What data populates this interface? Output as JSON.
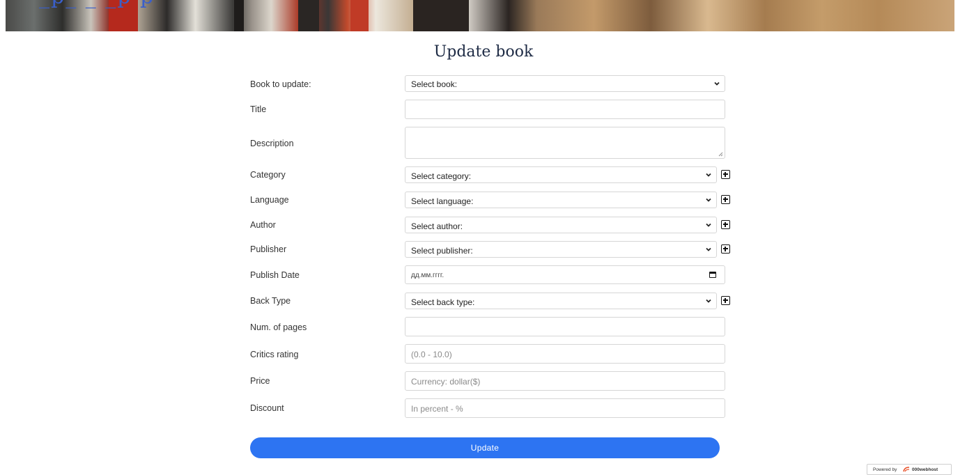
{
  "header": {
    "link_text": "_p_ _ _p p"
  },
  "page_title": "Update book",
  "form": {
    "book_to_update": {
      "label": "Book to update:",
      "value": "Select book:"
    },
    "title": {
      "label": "Title",
      "value": ""
    },
    "description": {
      "label": "Description",
      "value": ""
    },
    "category": {
      "label": "Category",
      "value": "Select category:"
    },
    "language": {
      "label": "Language",
      "value": "Select language:"
    },
    "author": {
      "label": "Author",
      "value": "Select author:"
    },
    "publisher": {
      "label": "Publisher",
      "value": "Select publisher:"
    },
    "publish_date": {
      "label": "Publish Date",
      "placeholder": "дд.мм.гггг."
    },
    "back_type": {
      "label": "Back Type",
      "value": "Select back type:"
    },
    "num_pages": {
      "label": "Num. of pages",
      "value": ""
    },
    "critics_rating": {
      "label": "Critics rating",
      "placeholder": "(0.0 - 10.0)"
    },
    "price": {
      "label": "Price",
      "placeholder": "Currency: dollar($)"
    },
    "discount": {
      "label": "Discount",
      "placeholder": "In percent - %"
    }
  },
  "update_button": "Update",
  "footer": {
    "powered_by": "Powered by",
    "host_name": "000webhost"
  },
  "icons": {
    "chevron": "chevron-down-icon",
    "add": "plus-square-icon",
    "calendar": "calendar-icon"
  }
}
